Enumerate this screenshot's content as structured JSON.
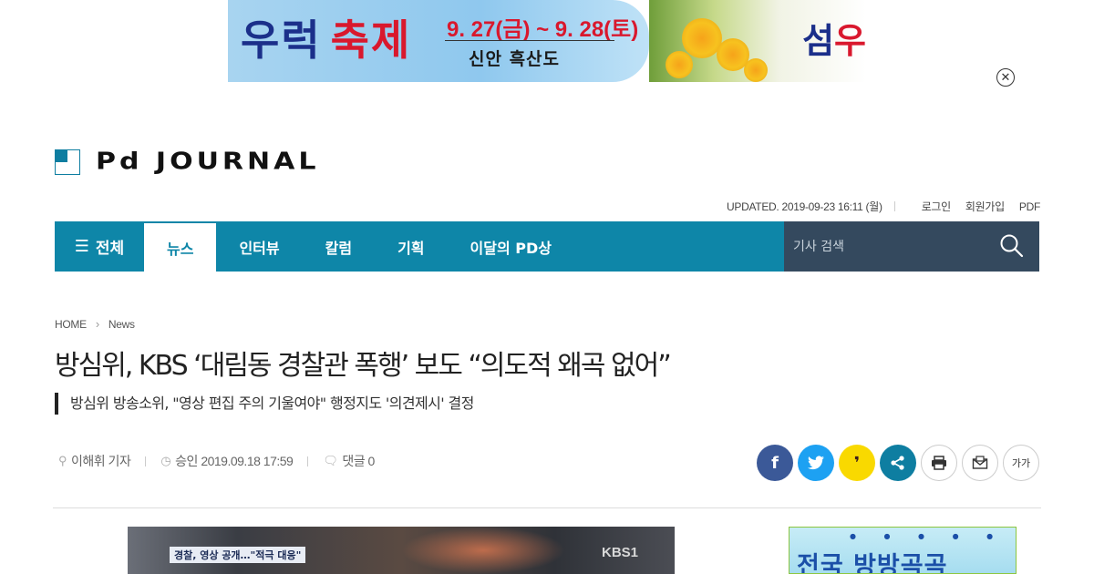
{
  "ad_banner": {
    "title_part1": "우럭",
    "title_part2": "축제",
    "dates": "9. 27(금) ~ 9. 28(토)",
    "place": "신안 흑산도",
    "right_text_part1": "섬",
    "right_text_part2": "우"
  },
  "ad_close": {
    "icon": "close-icon",
    "glyph": "✕"
  },
  "logo": {
    "text": "Pd JOURNAL"
  },
  "util": {
    "updated": "UPDATED. 2019-09-23 16:11 (월)",
    "login": "로그인",
    "signup": "회원가입",
    "pdf": "PDF"
  },
  "nav": {
    "all_label": "전체",
    "items": [
      {
        "label": "뉴스",
        "active": true
      },
      {
        "label": "인터뷰",
        "active": false
      },
      {
        "label": "칼럼",
        "active": false
      },
      {
        "label": "기획",
        "active": false
      },
      {
        "label": "이달의 PD상",
        "active": false
      }
    ],
    "search_placeholder": "기사 검색"
  },
  "breadcrumb": {
    "home": "HOME",
    "section": "News"
  },
  "article": {
    "headline": "방심위, KBS ‘대림동 경찰관 폭행’ 보도 “의도적 왜곡 없어”",
    "subhead": "방심위 방송소위, \"영상 편집 주의 기울여야\" 행정지도 '의견제시' 결정",
    "author": "이해휘 기자",
    "approved": "승인 2019.09.18 17:59",
    "comments": "댓글 0"
  },
  "share": {
    "facebook": "f",
    "twitter": "t",
    "kakaostory": "❜",
    "share": "share",
    "print": "print",
    "email": "email",
    "fontsize": "가가"
  },
  "article_image": {
    "caption": "경찰, 영상 공개…\"적극 대응\"",
    "logo": "KBS1"
  },
  "side_ad": {
    "text": "전국 방방곡곡"
  },
  "colors": {
    "accent": "#0e86a8",
    "search_bg": "#34495e"
  }
}
